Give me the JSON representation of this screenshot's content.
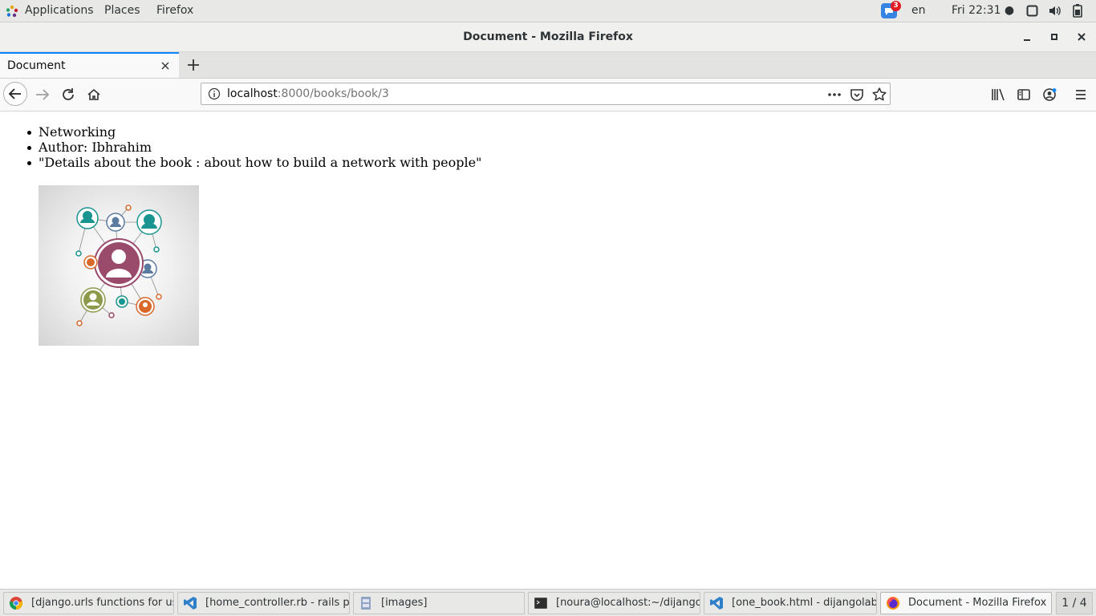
{
  "topbar": {
    "menus": [
      "Applications",
      "Places",
      "Firefox"
    ],
    "notification_count": "3",
    "language": "en",
    "clock": "Fri 22:31 ●"
  },
  "window": {
    "title": "Document - Mozilla Firefox"
  },
  "tab": {
    "label": "Document"
  },
  "navbar": {
    "url_host": "localhost",
    "url_path": ":8000/books/book/3"
  },
  "page": {
    "items": [
      "Networking",
      "Author: Ibhrahim",
      "\"Details about the book : about how to build a network with people\""
    ]
  },
  "taskbar": {
    "items": [
      {
        "label": "[django.urls functions for us..."
      },
      {
        "label": "[home_controller.rb - rails p..."
      },
      {
        "label": "[images]"
      },
      {
        "label": "[noura@localhost:~/dijangol..."
      },
      {
        "label": "[one_book.html - dijangolab..."
      },
      {
        "label": "Document - Mozilla Firefox"
      }
    ],
    "workspace": "1 / 4"
  },
  "colors": {
    "accent": "#0a84ff",
    "teal": "#1a9490",
    "plum": "#9a4a6b",
    "orange": "#d9682b",
    "olive": "#8c9a4a",
    "slate": "#5a7aa0"
  }
}
